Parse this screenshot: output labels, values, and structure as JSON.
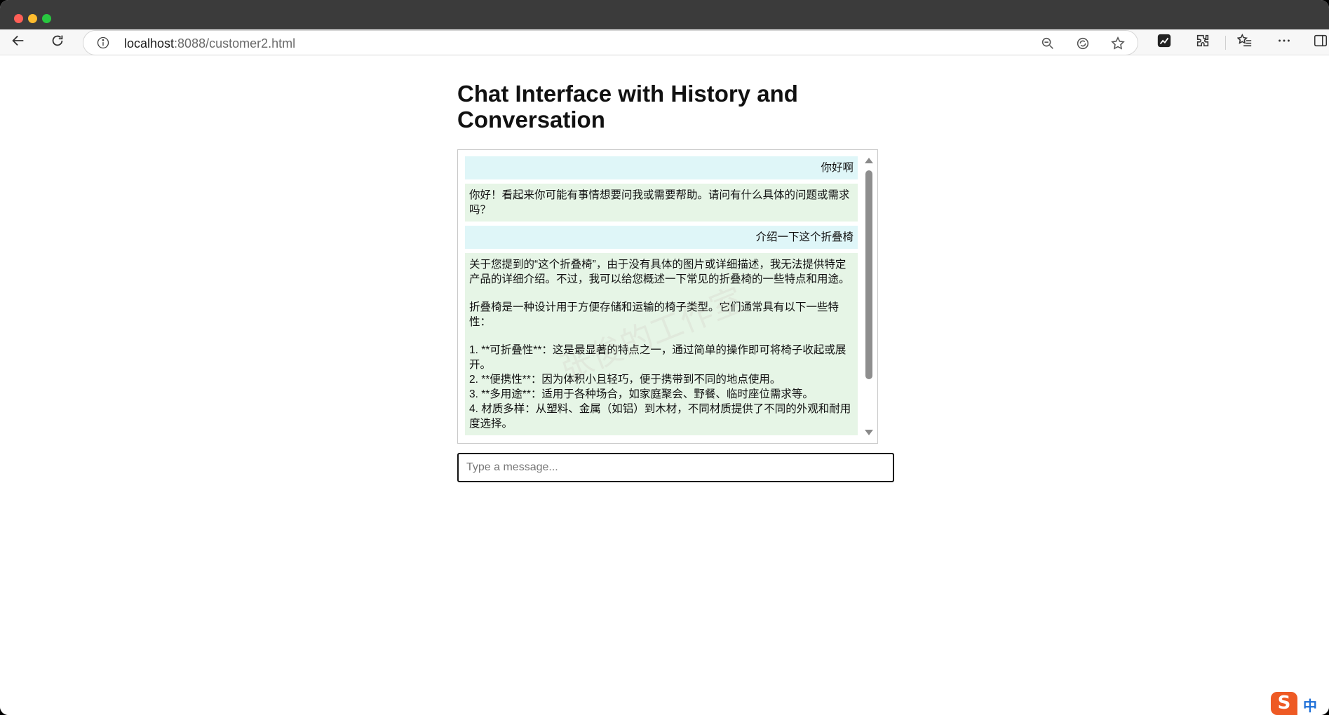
{
  "browser": {
    "url_host": "localhost",
    "url_rest": ":8088/customer2.html"
  },
  "page": {
    "title": "Chat Interface with History and Conversation",
    "input_placeholder": "Type a message..."
  },
  "messages": [
    {
      "role": "user",
      "lines": [
        "你好啊"
      ]
    },
    {
      "role": "bot",
      "lines": [
        "你好！看起来你可能有事情想要问我或需要帮助。请问有什么具体的问题或需求吗？"
      ]
    },
    {
      "role": "user",
      "lines": [
        "介绍一下这个折叠椅"
      ]
    },
    {
      "role": "bot",
      "paragraphs": [
        [
          "关于您提到的“这个折叠椅”，由于没有具体的图片或详细描述，我无法提供特定产品的详细介绍。不过，我可以给您概述一下常见的折叠椅的一些特点和用途。"
        ],
        [
          "折叠椅是一种设计用于方便存储和运输的椅子类型。它们通常具有以下一些特性："
        ],
        [
          "1. **可折叠性**：这是最显著的特点之一，通过简单的操作即可将椅子收起或展开。",
          "2. **便携性**：因为体积小且轻巧，便于携带到不同的地点使用。",
          "3. **多用途**：适用于各种场合，如家庭聚会、野餐、临时座位需求等。",
          "4. 材质多样：从塑料、金属（如铝）到木材，不同材质提供了不同的外观和耐用度选择。"
        ]
      ]
    }
  ],
  "watermark": "张俊的工作室",
  "ime": {
    "logo": "S",
    "label": "中"
  }
}
